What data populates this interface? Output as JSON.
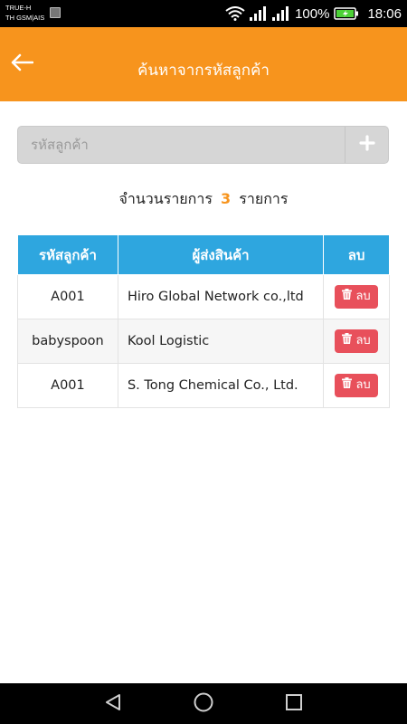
{
  "status_bar": {
    "carrier_line1": "TRUE-H",
    "carrier_line2": "TH GSM|AIS",
    "battery": "100%",
    "time": "18:06"
  },
  "header": {
    "title": "ค้นหาจากรหัสลูกค้า"
  },
  "search": {
    "placeholder": "รหัสลูกค้า",
    "value": ""
  },
  "summary": {
    "prefix": "จำนวนรายการ",
    "count": "3",
    "suffix": "รายการ"
  },
  "table": {
    "headers": [
      "รหัสลูกค้า",
      "ผู้ส่งสินค้า",
      "ลบ"
    ],
    "rows": [
      {
        "code": "A001",
        "shipper": "Hiro Global Network co.,ltd",
        "delete_label": "ลบ"
      },
      {
        "code": "babyspoon",
        "shipper": "Kool Logistic",
        "delete_label": "ลบ"
      },
      {
        "code": "A001",
        "shipper": "S. Tong Chemical Co., Ltd.",
        "delete_label": "ลบ"
      }
    ]
  },
  "colors": {
    "accent": "#f7941d",
    "table_header": "#2ea6df",
    "delete_button": "#e8505b"
  },
  "icons": {
    "back": "arrow-left-icon",
    "add": "plus-icon",
    "delete": "trash-icon",
    "nav": [
      "back-triangle-icon",
      "home-circle-icon",
      "recents-square-icon"
    ]
  }
}
